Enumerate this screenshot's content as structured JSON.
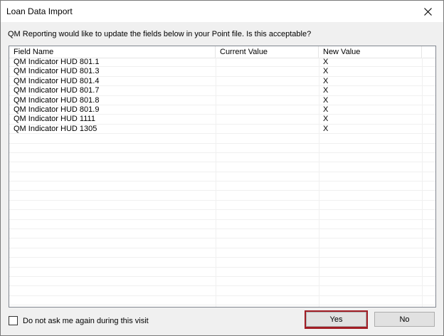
{
  "window": {
    "title": "Loan Data Import"
  },
  "prompt": "QM Reporting would like to update the fields below in your Point file. Is this acceptable?",
  "table": {
    "columns": [
      "Field Name",
      "Current Value",
      "New Value"
    ],
    "rows": [
      [
        "QM Indicator HUD 801.1",
        "",
        "X"
      ],
      [
        "QM Indicator HUD 801.3",
        "",
        "X"
      ],
      [
        "QM Indicator HUD 801.4",
        "",
        "X"
      ],
      [
        "QM Indicator HUD 801.7",
        "",
        "X"
      ],
      [
        "QM Indicator HUD 801.8",
        "",
        "X"
      ],
      [
        "QM Indicator HUD 801.9",
        "",
        "X"
      ],
      [
        "QM Indicator HUD 1111",
        "",
        "X"
      ],
      [
        "QM Indicator HUD 1305",
        "",
        "X"
      ]
    ]
  },
  "footer": {
    "checkbox_label": "Do not ask me again during this visit",
    "checkbox_checked": false,
    "yes_label": "Yes",
    "no_label": "No"
  },
  "colors": {
    "highlight": "#a11d25"
  }
}
